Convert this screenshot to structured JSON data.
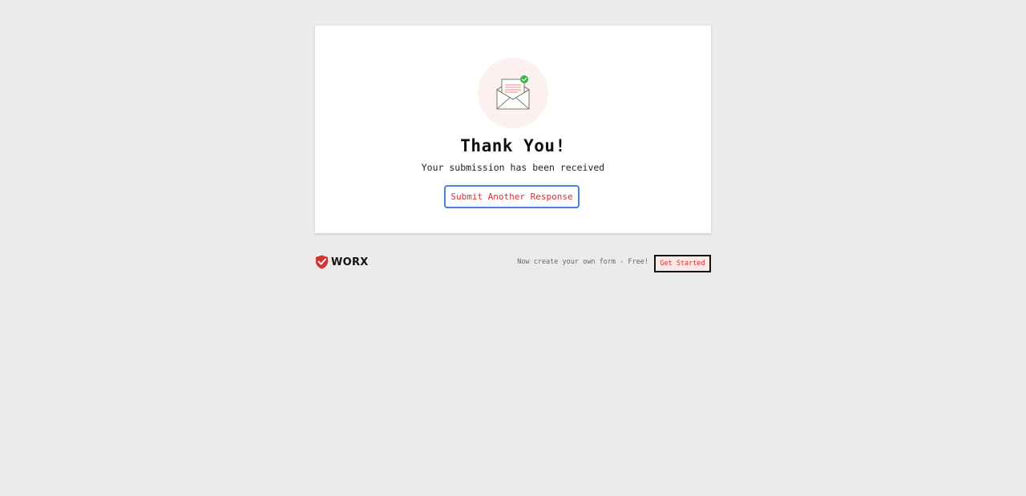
{
  "confirmation": {
    "title": "Thank You!",
    "message": "Your submission has been received",
    "submit_another_label": "Submit Another Response",
    "illustration_icon": "envelope-check-icon"
  },
  "footer": {
    "brand_name": "WORX",
    "brand_icon": "shield-check-icon",
    "promo_text": "Now create your own form - Free!",
    "get_started_label": "Get Started"
  },
  "colors": {
    "background": "#ebebeb",
    "accent_red": "#d92f2f",
    "focus_blue": "#4a7fe0",
    "success_green": "#3bb54a"
  }
}
